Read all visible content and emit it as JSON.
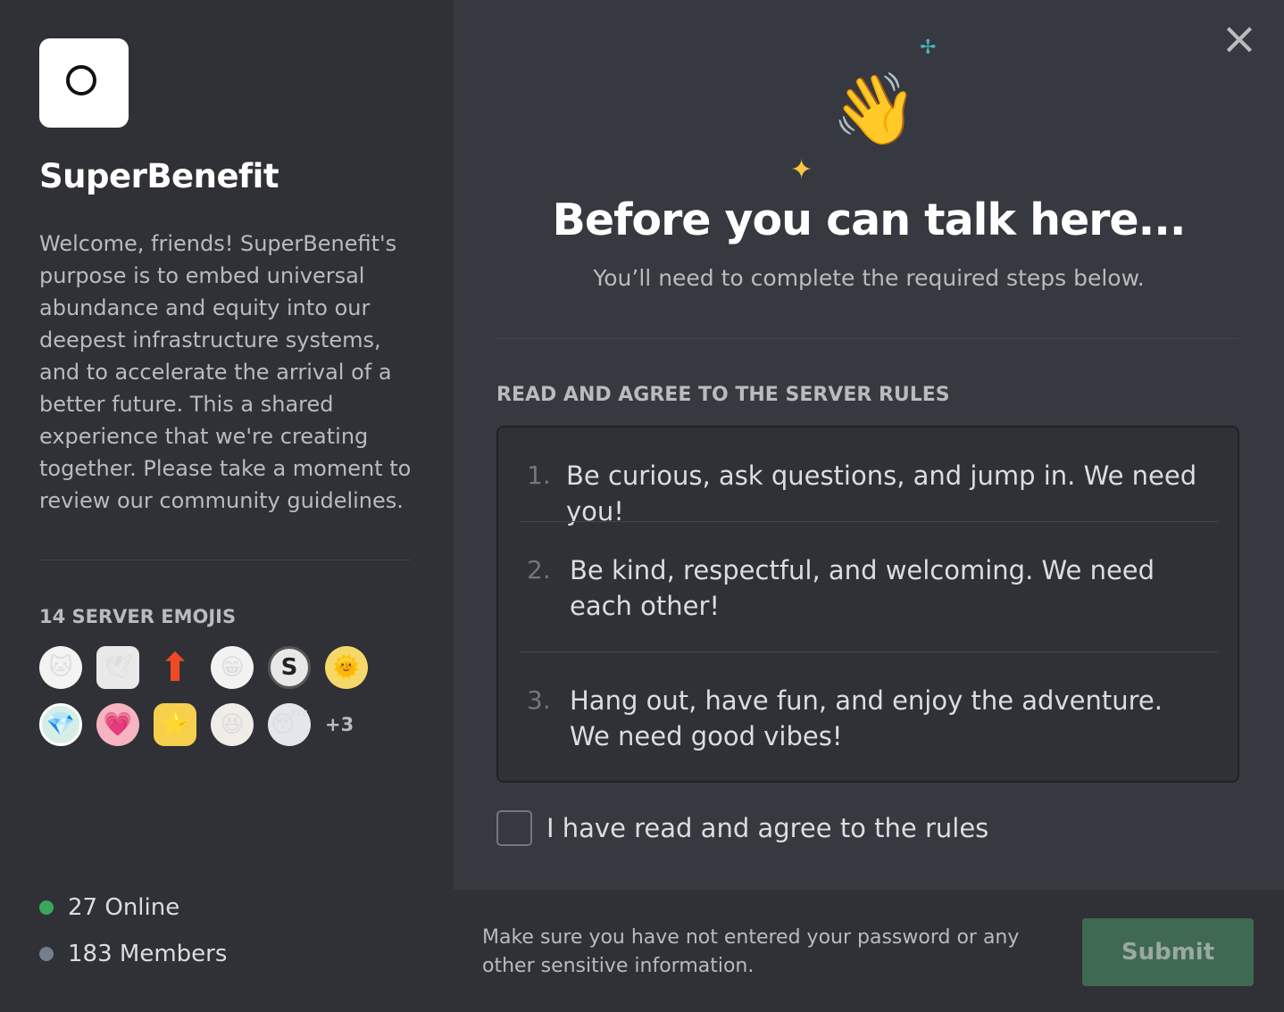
{
  "server": {
    "name": "SuperBenefit",
    "description": "Welcome, friends! SuperBenefit's purpose is to embed universal abundance and equity into our deepest infrastructure systems, and to accelerate the arrival of a better future. This a shared experience that we're creating together. Please take a moment to review our community guidelines."
  },
  "emojis": {
    "heading": "14 SERVER EMOJIS",
    "more": "+3",
    "items": [
      {
        "icon": "cat-emoji",
        "glyph": "🐱"
      },
      {
        "icon": "bird-emoji",
        "glyph": "🕊"
      },
      {
        "icon": "up-arrow-emoji",
        "glyph": "⬆"
      },
      {
        "icon": "grin-emoji",
        "glyph": "😁"
      },
      {
        "icon": "s-coin-emoji",
        "glyph": "S"
      },
      {
        "icon": "sun-emoji",
        "glyph": "🌞"
      },
      {
        "icon": "gem-badge-emoji",
        "glyph": "💎"
      },
      {
        "icon": "heart-emoji",
        "glyph": "💗"
      },
      {
        "icon": "star-badge-emoji",
        "glyph": "⭐"
      },
      {
        "icon": "laughing-girl-emoji",
        "glyph": "😆"
      },
      {
        "icon": "sleepy-cat-emoji",
        "glyph": "😴"
      }
    ]
  },
  "stats": {
    "online": "27 Online",
    "members": "183 Members",
    "online_color": "#3ba55d",
    "members_color": "#747f8d"
  },
  "gate": {
    "title": "Before you can talk here...",
    "subtitle": "You’ll need to complete the required steps below.",
    "rules_heading": "READ AND AGREE TO THE SERVER RULES",
    "rules": [
      {
        "num": "1.",
        "text": "Be curious, ask questions, and jump in. We need you!"
      },
      {
        "num": "2.",
        "text": "Be kind, respectful, and welcoming. We need each other!"
      },
      {
        "num": "3.",
        "text": "Hang out, have fun, and enjoy the adventure. We need good vibes!"
      }
    ],
    "agree_label": "I have read and agree to the rules",
    "agree_checked": false
  },
  "footer": {
    "note": "Make sure you have not entered your password or any other sensitive information.",
    "submit_label": "Submit"
  },
  "icons": {
    "close": "close-icon",
    "wave": "waving-hand-icon"
  }
}
